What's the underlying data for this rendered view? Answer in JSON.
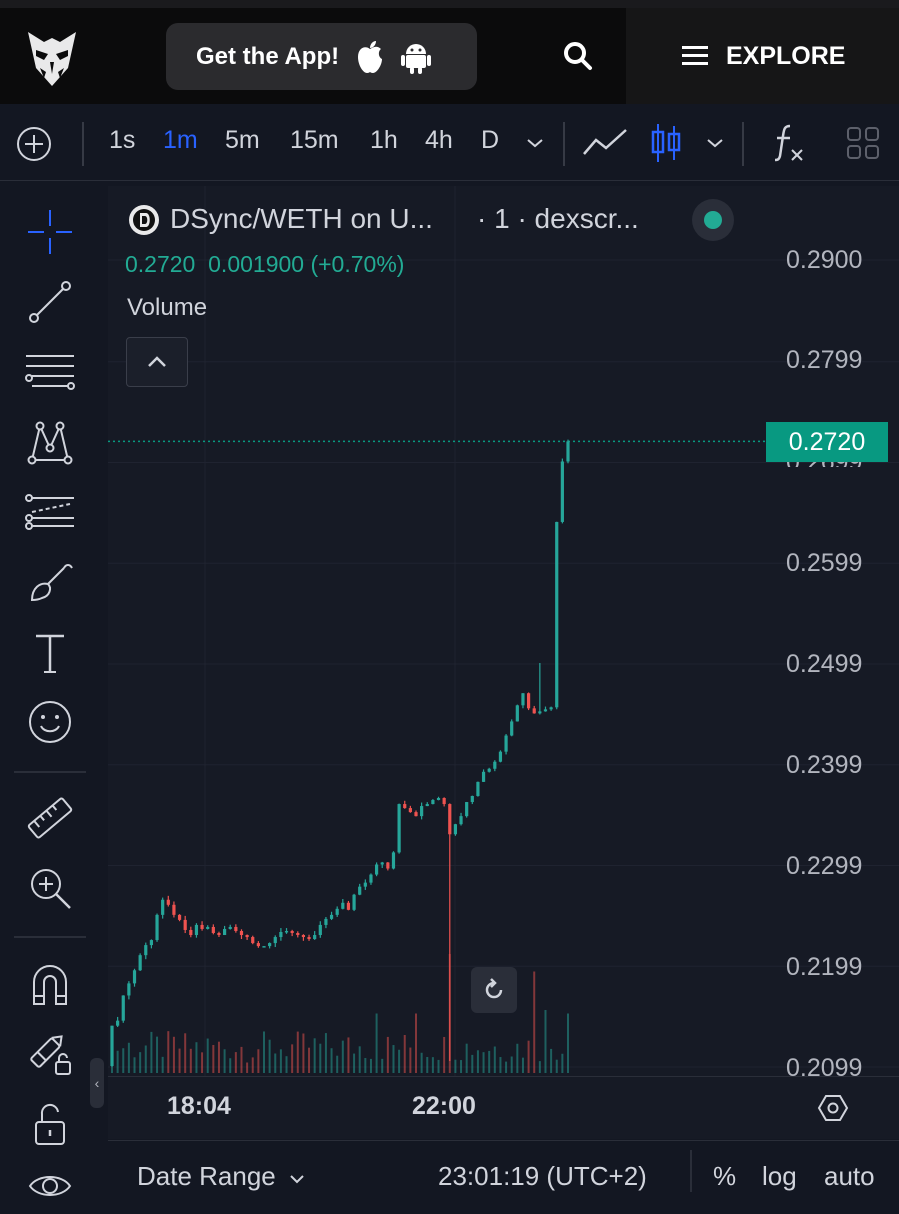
{
  "header": {
    "get_app_label": "Get the App!",
    "explore_label": "EXPLORE",
    "icons": [
      "owl-logo-icon",
      "apple-icon",
      "android-icon",
      "search-icon",
      "menu-icon"
    ]
  },
  "toolbar": {
    "intervals": [
      "1s",
      "1m",
      "5m",
      "15m",
      "1h",
      "4h",
      "D"
    ],
    "active_interval": "1m",
    "accent_color": "#2962ff"
  },
  "legend": {
    "title": "DSync/WETH on U...",
    "exchange": "· 1 · dexscr...",
    "last_price": "0.2720",
    "change": "0.001900 (+0.70%)",
    "volume_label": "Volume",
    "status_color": "#22ab94"
  },
  "price_axis": {
    "labels": [
      "0.2900",
      "0.2799",
      "0.2699",
      "0.2599",
      "0.2499",
      "0.2399",
      "0.2299",
      "0.2199",
      "0.2099"
    ],
    "current_price_tag": "0.2720"
  },
  "time_axis": {
    "labels": [
      "18:04",
      "22:00"
    ]
  },
  "bottom": {
    "date_range_label": "Date Range",
    "clock": "23:01:19 (UTC+2)",
    "percent_label": "%",
    "log_label": "log",
    "auto_label": "auto"
  },
  "chart_data": {
    "type": "candlestick",
    "pair": "DSync/WETH",
    "interval": "1m",
    "ylim": [
      0.2085,
      0.2925
    ],
    "up_color": "#26a69a",
    "down_color": "#ef5350",
    "last_price": 0.272,
    "closes": [
      0.214,
      0.2145,
      0.217,
      0.2182,
      0.2195,
      0.221,
      0.222,
      0.2225,
      0.225,
      0.2265,
      0.226,
      0.225,
      0.2245,
      0.2235,
      0.223,
      0.224,
      0.2236,
      0.2238,
      0.2232,
      0.223,
      0.2236,
      0.2238,
      0.2234,
      0.223,
      0.2228,
      0.2222,
      0.2219,
      0.2219,
      0.2222,
      0.2228,
      0.2233,
      0.2234,
      0.2232,
      0.223,
      0.2228,
      0.2226,
      0.223,
      0.224,
      0.2246,
      0.225,
      0.2256,
      0.2262,
      0.2255,
      0.227,
      0.2278,
      0.2282,
      0.229,
      0.23,
      0.2302,
      0.2296,
      0.2312,
      0.236,
      0.2356,
      0.2352,
      0.2348,
      0.2358,
      0.236,
      0.2364,
      0.2366,
      0.236,
      0.233,
      0.234,
      0.2348,
      0.2362,
      0.2368,
      0.2382,
      0.2392,
      0.2395,
      0.2402,
      0.2412,
      0.2428,
      0.2442,
      0.2458,
      0.247,
      0.2455,
      0.245,
      0.2452,
      0.2454,
      0.2456,
      0.264,
      0.27,
      0.272
    ],
    "volume_lim": [
      0,
      0.002
    ]
  }
}
